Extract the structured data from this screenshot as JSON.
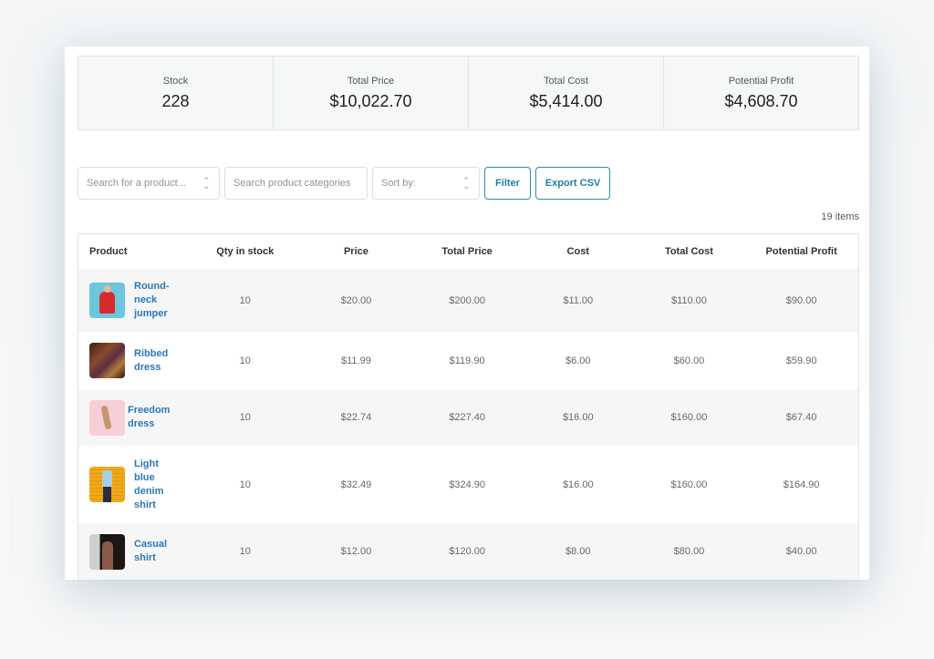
{
  "summary": [
    {
      "label": "Stock",
      "value": "228"
    },
    {
      "label": "Total Price",
      "value": "$10,022.70"
    },
    {
      "label": "Total Cost",
      "value": "$5,414.00"
    },
    {
      "label": "Potential Profit",
      "value": "$4,608.70"
    }
  ],
  "toolbar": {
    "product_search_placeholder": "Search for a product...",
    "category_search_placeholder": "Search product categories",
    "sort_label": "Sort by:",
    "filter_label": "Filter",
    "export_label": "Export CSV"
  },
  "item_count": "19 items",
  "table": {
    "headers": [
      "Product",
      "Qty in stock",
      "Price",
      "Total Price",
      "Cost",
      "Total Cost",
      "Potential Profit"
    ],
    "rows": [
      {
        "product": "Round-neck jumper",
        "thumb_icon": "red-jumper-photo",
        "qty": "10",
        "price": "$20.00",
        "total_price": "$200.00",
        "cost": "$11.00",
        "total_cost": "$110.00",
        "profit": "$90.00"
      },
      {
        "product": "Ribbed dress",
        "thumb_icon": "ribbed-dress-photo",
        "qty": "10",
        "price": "$11.99",
        "total_price": "$119.90",
        "cost": "$6.00",
        "total_cost": "$60.00",
        "profit": "$59.90"
      },
      {
        "product": "Freedom dress",
        "thumb_icon": "freedom-dress-photo",
        "qty": "10",
        "price": "$22.74",
        "total_price": "$227.40",
        "cost": "$16.00",
        "total_cost": "$160.00",
        "profit": "$67.40"
      },
      {
        "product": "Light blue denim shirt",
        "thumb_icon": "denim-shirt-photo",
        "qty": "10",
        "price": "$32.49",
        "total_price": "$324.90",
        "cost": "$16.00",
        "total_cost": "$160.00",
        "profit": "$164.90"
      },
      {
        "product": "Casual shirt",
        "thumb_icon": "casual-shirt-photo",
        "qty": "10",
        "price": "$12.00",
        "total_price": "$120.00",
        "cost": "$8.00",
        "total_cost": "$80.00",
        "profit": "$40.00"
      }
    ]
  },
  "colors": {
    "accent": "#1d7fa6",
    "link": "#2a78b8",
    "row_alt": "#f6f6f6"
  }
}
